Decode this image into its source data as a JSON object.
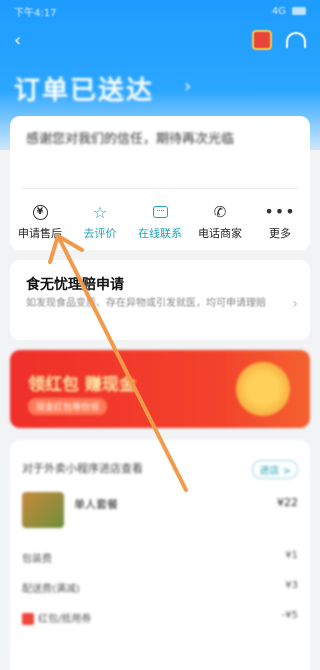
{
  "status_bar": {
    "time": "下午4:17",
    "right": "4G"
  },
  "page": {
    "title": "订单已送达",
    "message": "感谢您对我们的信任，期待再次光临"
  },
  "actions": [
    {
      "label": "申请售后",
      "icon": "refund-icon"
    },
    {
      "label": "去评价",
      "icon": "star-icon"
    },
    {
      "label": "在线联系",
      "icon": "chat-icon"
    },
    {
      "label": "电话商家",
      "icon": "phone-icon"
    },
    {
      "label": "更多",
      "icon": "more-icon"
    }
  ],
  "insurance": {
    "title": "食无忧理赔申请",
    "desc": "如发现食品变质、存在异物或引发就医，均可申请理赔"
  },
  "banner": {
    "title": "领红包 赚现金",
    "subtitle": "现金红包等你领"
  },
  "order": {
    "shop_name": "对于外卖小程序进店查看",
    "shop_pill": "进店 >",
    "item_name": "单人套餐",
    "item_price": "¥22",
    "fees": [
      {
        "label": "包装费",
        "value": "¥1"
      },
      {
        "label": "配送费(满减)",
        "value": "¥3"
      },
      {
        "label": "红包/抵用券",
        "value": "-¥5"
      }
    ]
  },
  "colors": {
    "primary_blue": "#1e9cff",
    "teal": "#1fa4b5",
    "annotation_orange": "#f2994a"
  }
}
